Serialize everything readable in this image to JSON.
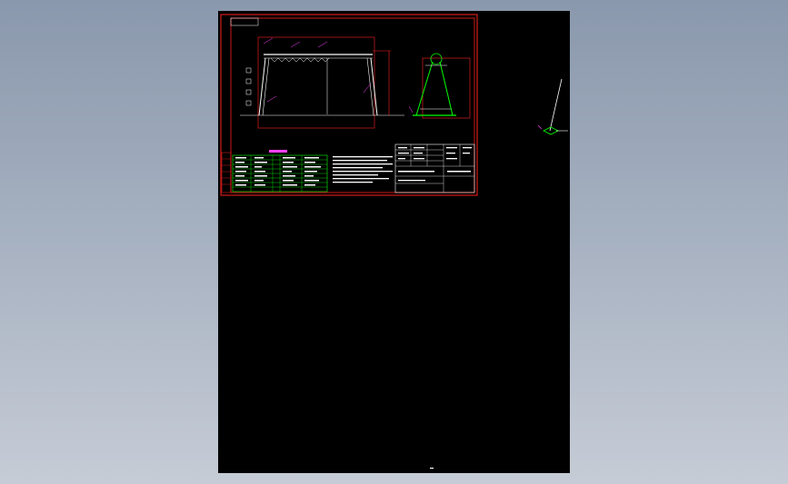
{
  "viewer": {
    "background_top": "#8a98ad",
    "background_bottom": "#c6ccd6",
    "paper_color": "#000000"
  },
  "drawing": {
    "table_heading": "",
    "title_block_rows": [
      "",
      "",
      "",
      ""
    ],
    "colors": {
      "frame": "#ff2020",
      "structure": "#ffffff",
      "dimension": "#ff2020",
      "table": "#00ff00",
      "annotation": "#ff40ff",
      "accent": "#00ffff"
    },
    "icons": [
      "crane-front-view",
      "crane-side-view",
      "notes-block",
      "title-block",
      "loose-sketch"
    ]
  }
}
